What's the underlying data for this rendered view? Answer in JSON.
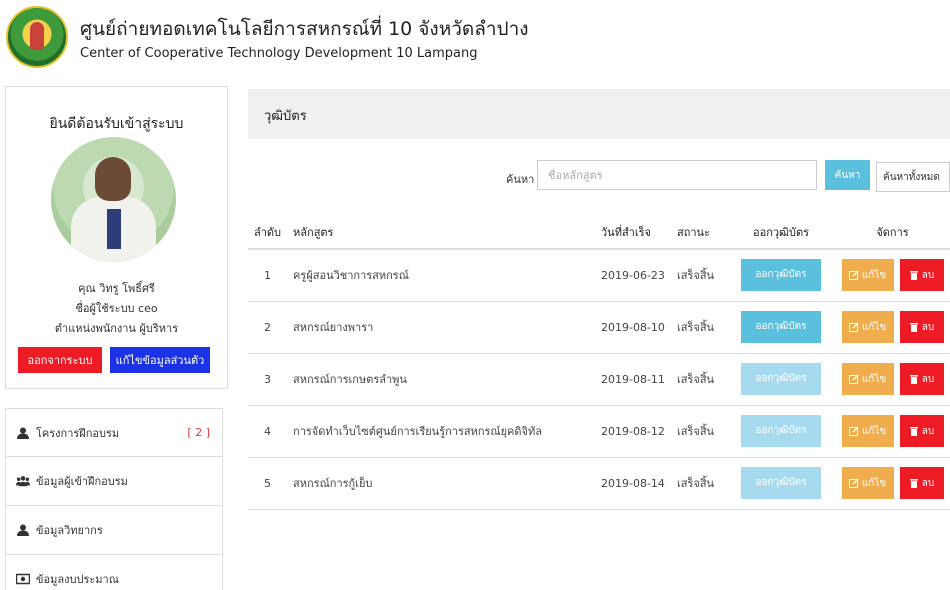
{
  "header": {
    "title_th": "ศูนย์ถ่ายทอดเทคโนโลยีการสหกรณ์ที่ 10 จังหวัดลำปาง",
    "title_en": "Center of Cooperative Technology Development 10 Lampang"
  },
  "profile": {
    "welcome": "ยินดีต้อนรับเข้าสู่ระบบ",
    "name": "คุณ วิทรู โพธิ์ศรี",
    "username": "ชื่อผู้ใช้ระบบ ceo",
    "position": "ตำแหน่งพนักงาน ผู้บริหาร",
    "logout_label": "ออกจากระบบ",
    "edit_label": "แก้ไขข้อมูลส่วนตัว"
  },
  "menu": [
    {
      "label": "โครงการฝึกอบรม",
      "count": "[ 2 ]",
      "icon": "user-icon"
    },
    {
      "label": "ข้อมูลผู้เข้าฝึกอบรม",
      "count": "",
      "icon": "users-icon"
    },
    {
      "label": "ข้อมูลวิทยากร",
      "count": "",
      "icon": "user-icon"
    },
    {
      "label": "ข้อมูลงบประมาณ",
      "count": "",
      "icon": "money-icon"
    }
  ],
  "main": {
    "heading": "วุฒิบัตร",
    "search_label": "ค้นหา",
    "search_placeholder": "ชื่อหลักสูตร",
    "search_button": "ค้นหา",
    "search_all_button": "ค้นหาทั้งหมด",
    "columns": [
      "ลำดับ",
      "หลักสูตร",
      "วันที่สำเร็จ",
      "สถานะ",
      "ออกวุฒิบัตร",
      "จัดการ"
    ],
    "rows": [
      {
        "no": "1",
        "course": "ครูผู้สอนวิชาการสหกรณ์",
        "date": "2019-06-23",
        "status": "เสร็จสิ้น",
        "cert": "ออกวุฒิบัตร",
        "edit": "แก้ไข",
        "del": "ลบ"
      },
      {
        "no": "2",
        "course": "สหกรณ์ยางพารา",
        "date": "2019-08-10",
        "status": "เสร็จสิ้น",
        "cert": "ออกวุฒิบัตร",
        "edit": "แก้ไข",
        "del": "ลบ"
      },
      {
        "no": "3",
        "course": "สหกรณ์การเกษตรลำพูน",
        "date": "2019-08-11",
        "status": "เสร็จสิ้น",
        "cert": "ออกวุฒิบัตร",
        "edit": "แก้ไข",
        "del": "ลบ"
      },
      {
        "no": "4",
        "course": "การจัดทำเว็บไซต์ศูนย์การเรียนรู้การสหกรณ์ยุคดิจิทัล",
        "date": "2019-08-12",
        "status": "เสร็จสิ้น",
        "cert": "ออกวุฒิบัตร",
        "edit": "แก้ไข",
        "del": "ลบ"
      },
      {
        "no": "5",
        "course": "สหกรณ์การกู้เย็บ",
        "date": "2019-08-14",
        "status": "เสร็จสิ้น",
        "cert": "ออกวุฒิบัตร",
        "edit": "แก้ไข",
        "del": "ลบ"
      }
    ]
  },
  "colors": {
    "info": "#5bc0de",
    "warning": "#f0ad4e",
    "danger": "#ed1c24",
    "primary": "#1c32e6"
  }
}
